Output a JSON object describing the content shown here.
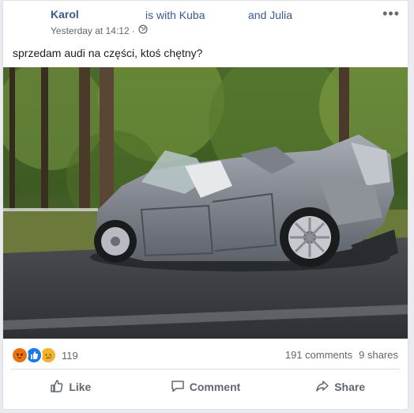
{
  "post": {
    "author": "Karol",
    "with_text": "is with Kuba",
    "and_text": "and Julia",
    "timestamp": "Yesterday at 14:12 ·",
    "text": "sprzedam audi na części, ktoś chętny?",
    "photo_icon": "crashed-car-photo"
  },
  "reactions": {
    "icons": [
      "angry-reaction-icon",
      "like-reaction-icon",
      "sad-reaction-icon"
    ],
    "count": "119"
  },
  "counts": {
    "comments": "191 comments",
    "shares": "9 shares"
  },
  "actions": {
    "like": "Like",
    "comment": "Comment",
    "share": "Share"
  },
  "colors": {
    "link": "#385898",
    "muted": "#606770",
    "text": "#1c1e21"
  }
}
